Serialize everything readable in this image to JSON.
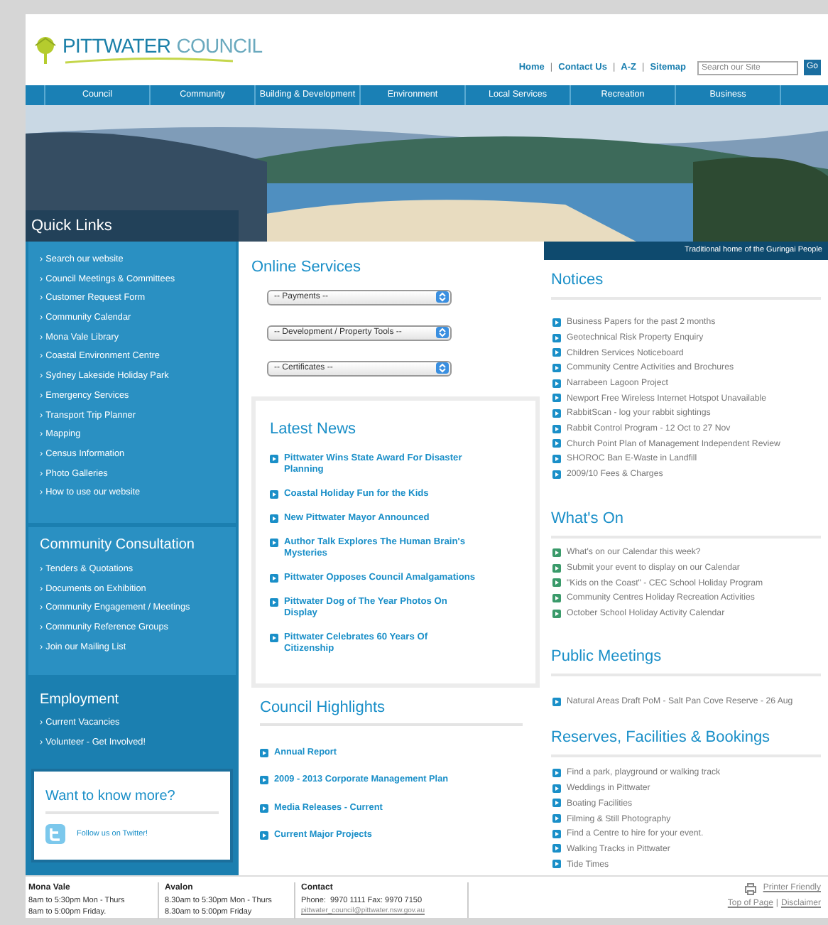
{
  "header": {
    "logo_name": "PITTWATER",
    "logo_suffix": "COUNCIL",
    "top_links": [
      "Home",
      "Contact Us",
      "A-Z",
      "Sitemap"
    ],
    "separator": "|",
    "search": {
      "placeholder": "Search our Site",
      "button": "Go"
    }
  },
  "nav": [
    "Council",
    "Community",
    "Building & Development",
    "Environment",
    "Local Services",
    "Recreation",
    "Business"
  ],
  "banner": {
    "caption": "Traditional home of the Guringai People"
  },
  "sidebar": {
    "marker": "›",
    "quick_links": {
      "title": "Quick Links",
      "items": [
        "Search our website",
        "Council Meetings & Committees",
        "Customer Request Form",
        "Community Calendar",
        "Mona Vale Library",
        "Coastal Environment Centre",
        "Sydney Lakeside Holiday Park",
        "Emergency Services",
        "Transport Trip Planner",
        "Mapping",
        "Census Information",
        "Photo Galleries",
        "How to use our website"
      ]
    },
    "consultation": {
      "title": "Community Consultation",
      "items": [
        "Tenders & Quotations",
        "Documents on Exhibition",
        "Community Engagement / Meetings",
        "Community Reference Groups",
        "Join our Mailing List"
      ]
    },
    "employment": {
      "title": "Employment",
      "items": [
        "Current Vacancies",
        "Volunteer - Get Involved!"
      ]
    },
    "want_to_know": {
      "title": "Want to know more?",
      "twitter": "Follow us on Twitter!"
    }
  },
  "online_services": {
    "title": "Online Services",
    "selects": [
      "-- Payments --",
      "-- Development / Property Tools --",
      "-- Certificates --"
    ]
  },
  "latest_news": {
    "title": "Latest News",
    "items": [
      "Pittwater Wins State Award For Disaster Planning",
      "Coastal Holiday Fun for the Kids",
      "New Pittwater Mayor Announced",
      "Author Talk Explores The Human Brain's Mysteries",
      "Pittwater Opposes Council Amalgamations",
      "Pittwater Dog of The Year Photos On Display",
      "Pittwater Celebrates 60 Years Of Citizenship"
    ]
  },
  "council_highlights": {
    "title": "Council Highlights",
    "items": [
      "Annual Report",
      "2009 - 2013 Corporate Management Plan",
      "Media Releases - Current",
      "Current Major Projects"
    ]
  },
  "notices": {
    "title": "Notices",
    "items": [
      "Business Papers for the past 2 months",
      "Geotechnical Risk Property Enquiry",
      "Children Services Noticeboard",
      "Community Centre Activities and Brochures",
      "Narrabeen Lagoon Project",
      "Newport Free Wireless Internet Hotspot Unavailable",
      "RabbitScan - log your rabbit sightings",
      "Rabbit Control Program - 12 Oct to 27 Nov",
      "Church Point Plan of Management Independent Review",
      "SHOROC Ban E-Waste in Landfill",
      "2009/10 Fees & Charges"
    ]
  },
  "whats_on": {
    "title": "What's On",
    "items": [
      "What's on our Calendar this week?",
      "Submit your event to display on our Calendar",
      "\"Kids on the Coast\" - CEC School Holiday Program",
      "Community Centres Holiday Recreation Activities",
      "October School Holiday Activity Calendar"
    ]
  },
  "public_meetings": {
    "title": "Public Meetings",
    "items": [
      "Natural Areas Draft PoM - Salt Pan Cove Reserve - 26 Aug"
    ]
  },
  "reserves": {
    "title": "Reserves, Facilities & Bookings",
    "items": [
      "Find a park, playground or walking track",
      "Weddings in Pittwater",
      "Boating Facilities",
      "Filming & Still Photography",
      "Find a Centre to hire for your event.",
      "Walking Tracks in Pittwater",
      "Tide Times"
    ]
  },
  "footer": {
    "locations": [
      {
        "name": "Mona Vale",
        "lines": [
          "8am to 5:30pm Mon - Thurs",
          "8am to 5:00pm Friday."
        ]
      },
      {
        "name": "Avalon",
        "lines": [
          "8.30am to 5:30pm Mon - Thurs",
          "8.30am to 5:00pm Friday"
        ]
      }
    ],
    "contact": {
      "title": "Contact",
      "phone": "Phone:  9970 1111 Fax: 9970 7150",
      "email": "pittwater_council@pittwater.nsw.gov.au"
    },
    "printer_friendly": "Printer Friendly",
    "top_of_page": "Top of Page",
    "separator": "|",
    "disclaimer": "Disclaimer"
  }
}
